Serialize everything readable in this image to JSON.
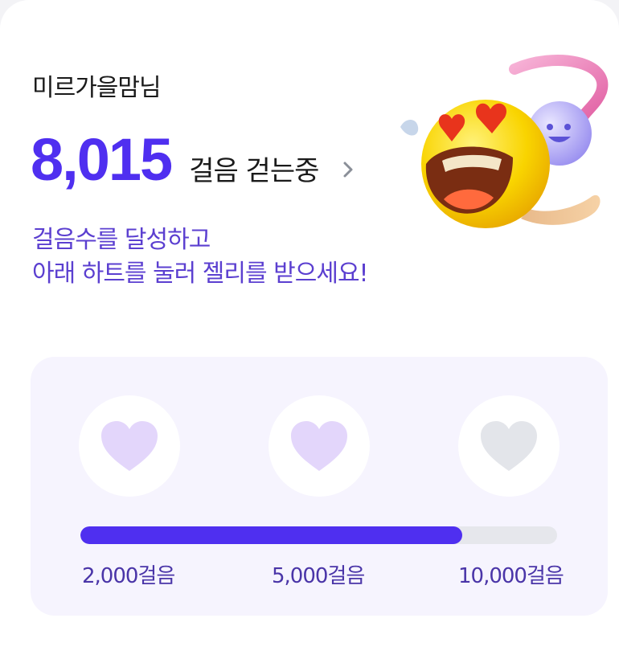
{
  "user": {
    "name": "미르가을맘님"
  },
  "steps": {
    "count": "8,015",
    "label": "걸음 걷는중"
  },
  "instruction": {
    "line1": "걸음수를 달성하고",
    "line2": "아래 하트를 눌러 젤리를 받으세요!"
  },
  "rewards": {
    "progress_fraction": 0.8015,
    "colors": {
      "accent": "#4f2ff0",
      "heart_achieved": "#e3d6fb",
      "heart_locked": "#e3e5ea",
      "track": "#e6e7ec"
    },
    "milestones": [
      {
        "label": "2,000걸음",
        "achieved": true
      },
      {
        "label": "5,000걸음",
        "achieved": true
      },
      {
        "label": "10,000걸음",
        "achieved": false
      }
    ]
  },
  "icons": {
    "chevron": "chevron-right-icon",
    "heart": "heart-icon",
    "mascot": "heart-eyes-emoji-mascot"
  }
}
